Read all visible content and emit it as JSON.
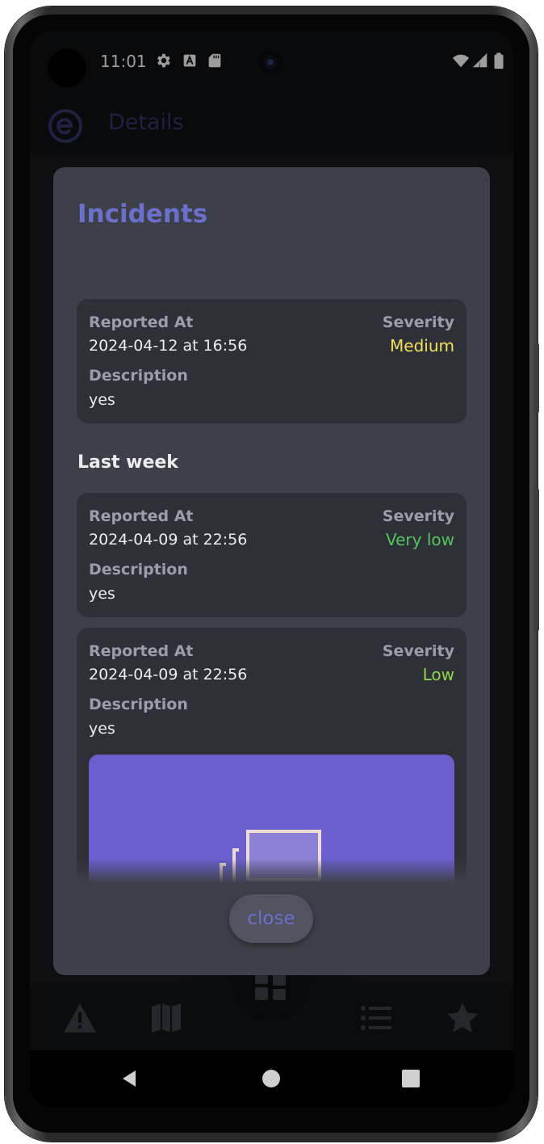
{
  "status_bar": {
    "time": "11:01",
    "icons_left": [
      "settings-icon",
      "a-box-icon",
      "sd-card-icon"
    ],
    "icons_right": [
      "wifi-icon",
      "signal-icon",
      "battery-icon"
    ]
  },
  "app_bar": {
    "title": "Details",
    "logo": "e-logo-icon"
  },
  "dialog": {
    "title": "Incidents",
    "close_label": "close",
    "incidents": [
      {
        "reported_label": "Reported At",
        "reported_value": "2024-04-12 at 16:56",
        "severity_label": "Severity",
        "severity_value": "Medium",
        "severity_color": "#f4e05a",
        "description_label": "Description",
        "description_value": "yes"
      }
    ],
    "sections": [
      {
        "header": "Last week",
        "incidents": [
          {
            "reported_label": "Reported At",
            "reported_value": "2024-04-09 at 22:56",
            "severity_label": "Severity",
            "severity_value": "Very low",
            "severity_color": "#55c45f",
            "description_label": "Description",
            "description_value": "yes"
          },
          {
            "reported_label": "Reported At",
            "reported_value": "2024-04-09 at 22:56",
            "severity_label": "Severity",
            "severity_value": "Low",
            "severity_color": "#8fd64a",
            "description_label": "Description",
            "description_value": "yes",
            "image_icon": "image-gallery-icon"
          }
        ]
      }
    ]
  },
  "bottom_nav": {
    "items": [
      "warning-icon",
      "map-icon",
      "dashboard-icon",
      "list-icon",
      "star-icon"
    ]
  },
  "system_nav": {
    "items": [
      "back-icon",
      "home-icon",
      "recents-icon"
    ]
  },
  "colors": {
    "accent": "#6b70cc",
    "dialog_bg": "#3d4048",
    "card_bg": "#2e3038",
    "image_bg": "#6a5fcc"
  }
}
